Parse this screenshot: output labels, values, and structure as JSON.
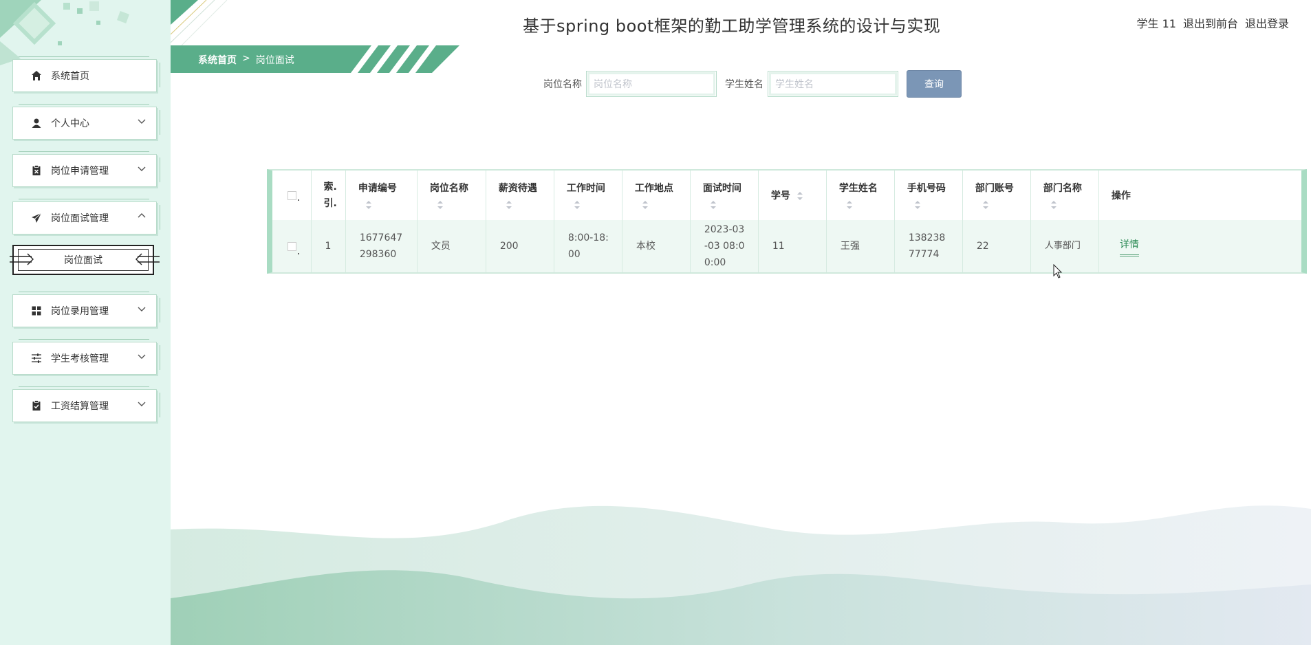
{
  "header": {
    "title": "基于spring boot框架的勤工助学管理系统的设计与实现",
    "user_label": "学生 11",
    "back_to_front": "退出到前台",
    "logout": "退出登录"
  },
  "breadcrumb": {
    "home": "系统首页",
    "separator": ">",
    "current": "岗位面试"
  },
  "sidebar": {
    "items": [
      {
        "label": "系统首页",
        "icon": "home-icon"
      },
      {
        "label": "个人中心",
        "icon": "user-icon"
      },
      {
        "label": "岗位申请管理",
        "icon": "clipboard-icon"
      },
      {
        "label": "岗位面试管理",
        "icon": "send-icon"
      },
      {
        "label": "岗位录用管理",
        "icon": "grid-icon"
      },
      {
        "label": "学生考核管理",
        "icon": "sliders-icon"
      },
      {
        "label": "工资结算管理",
        "icon": "checklist-icon"
      }
    ],
    "submenu": {
      "label": "岗位面试"
    }
  },
  "search": {
    "position_label": "岗位名称",
    "position_placeholder": "岗位名称",
    "student_label": "学生姓名",
    "student_placeholder": "学生姓名",
    "button": "查询"
  },
  "table": {
    "headers": [
      "索引",
      "申请编号",
      "岗位名称",
      "薪资待遇",
      "工作时间",
      "工作地点",
      "面试时间",
      "学号",
      "学生姓名",
      "手机号码",
      "部门账号",
      "部门名称",
      "操作"
    ],
    "index_header_line1": "索.",
    "index_header_line2": "引.",
    "rows": [
      {
        "index": "1",
        "application_no": "1677647298360",
        "position": "文员",
        "salary": "200",
        "work_time": "8:00-18:00",
        "work_place": "本校",
        "interview_time": "2023-03-03 08:00:00",
        "student_no": "11",
        "student_name": "王强",
        "phone": "13823877774",
        "dept_account": "22",
        "dept_name": "人事部门",
        "action": "详情"
      }
    ]
  },
  "colors": {
    "accent": "#5aae8a",
    "sidebar_bg": "#e1f5ee",
    "button": "#7b96b6"
  }
}
